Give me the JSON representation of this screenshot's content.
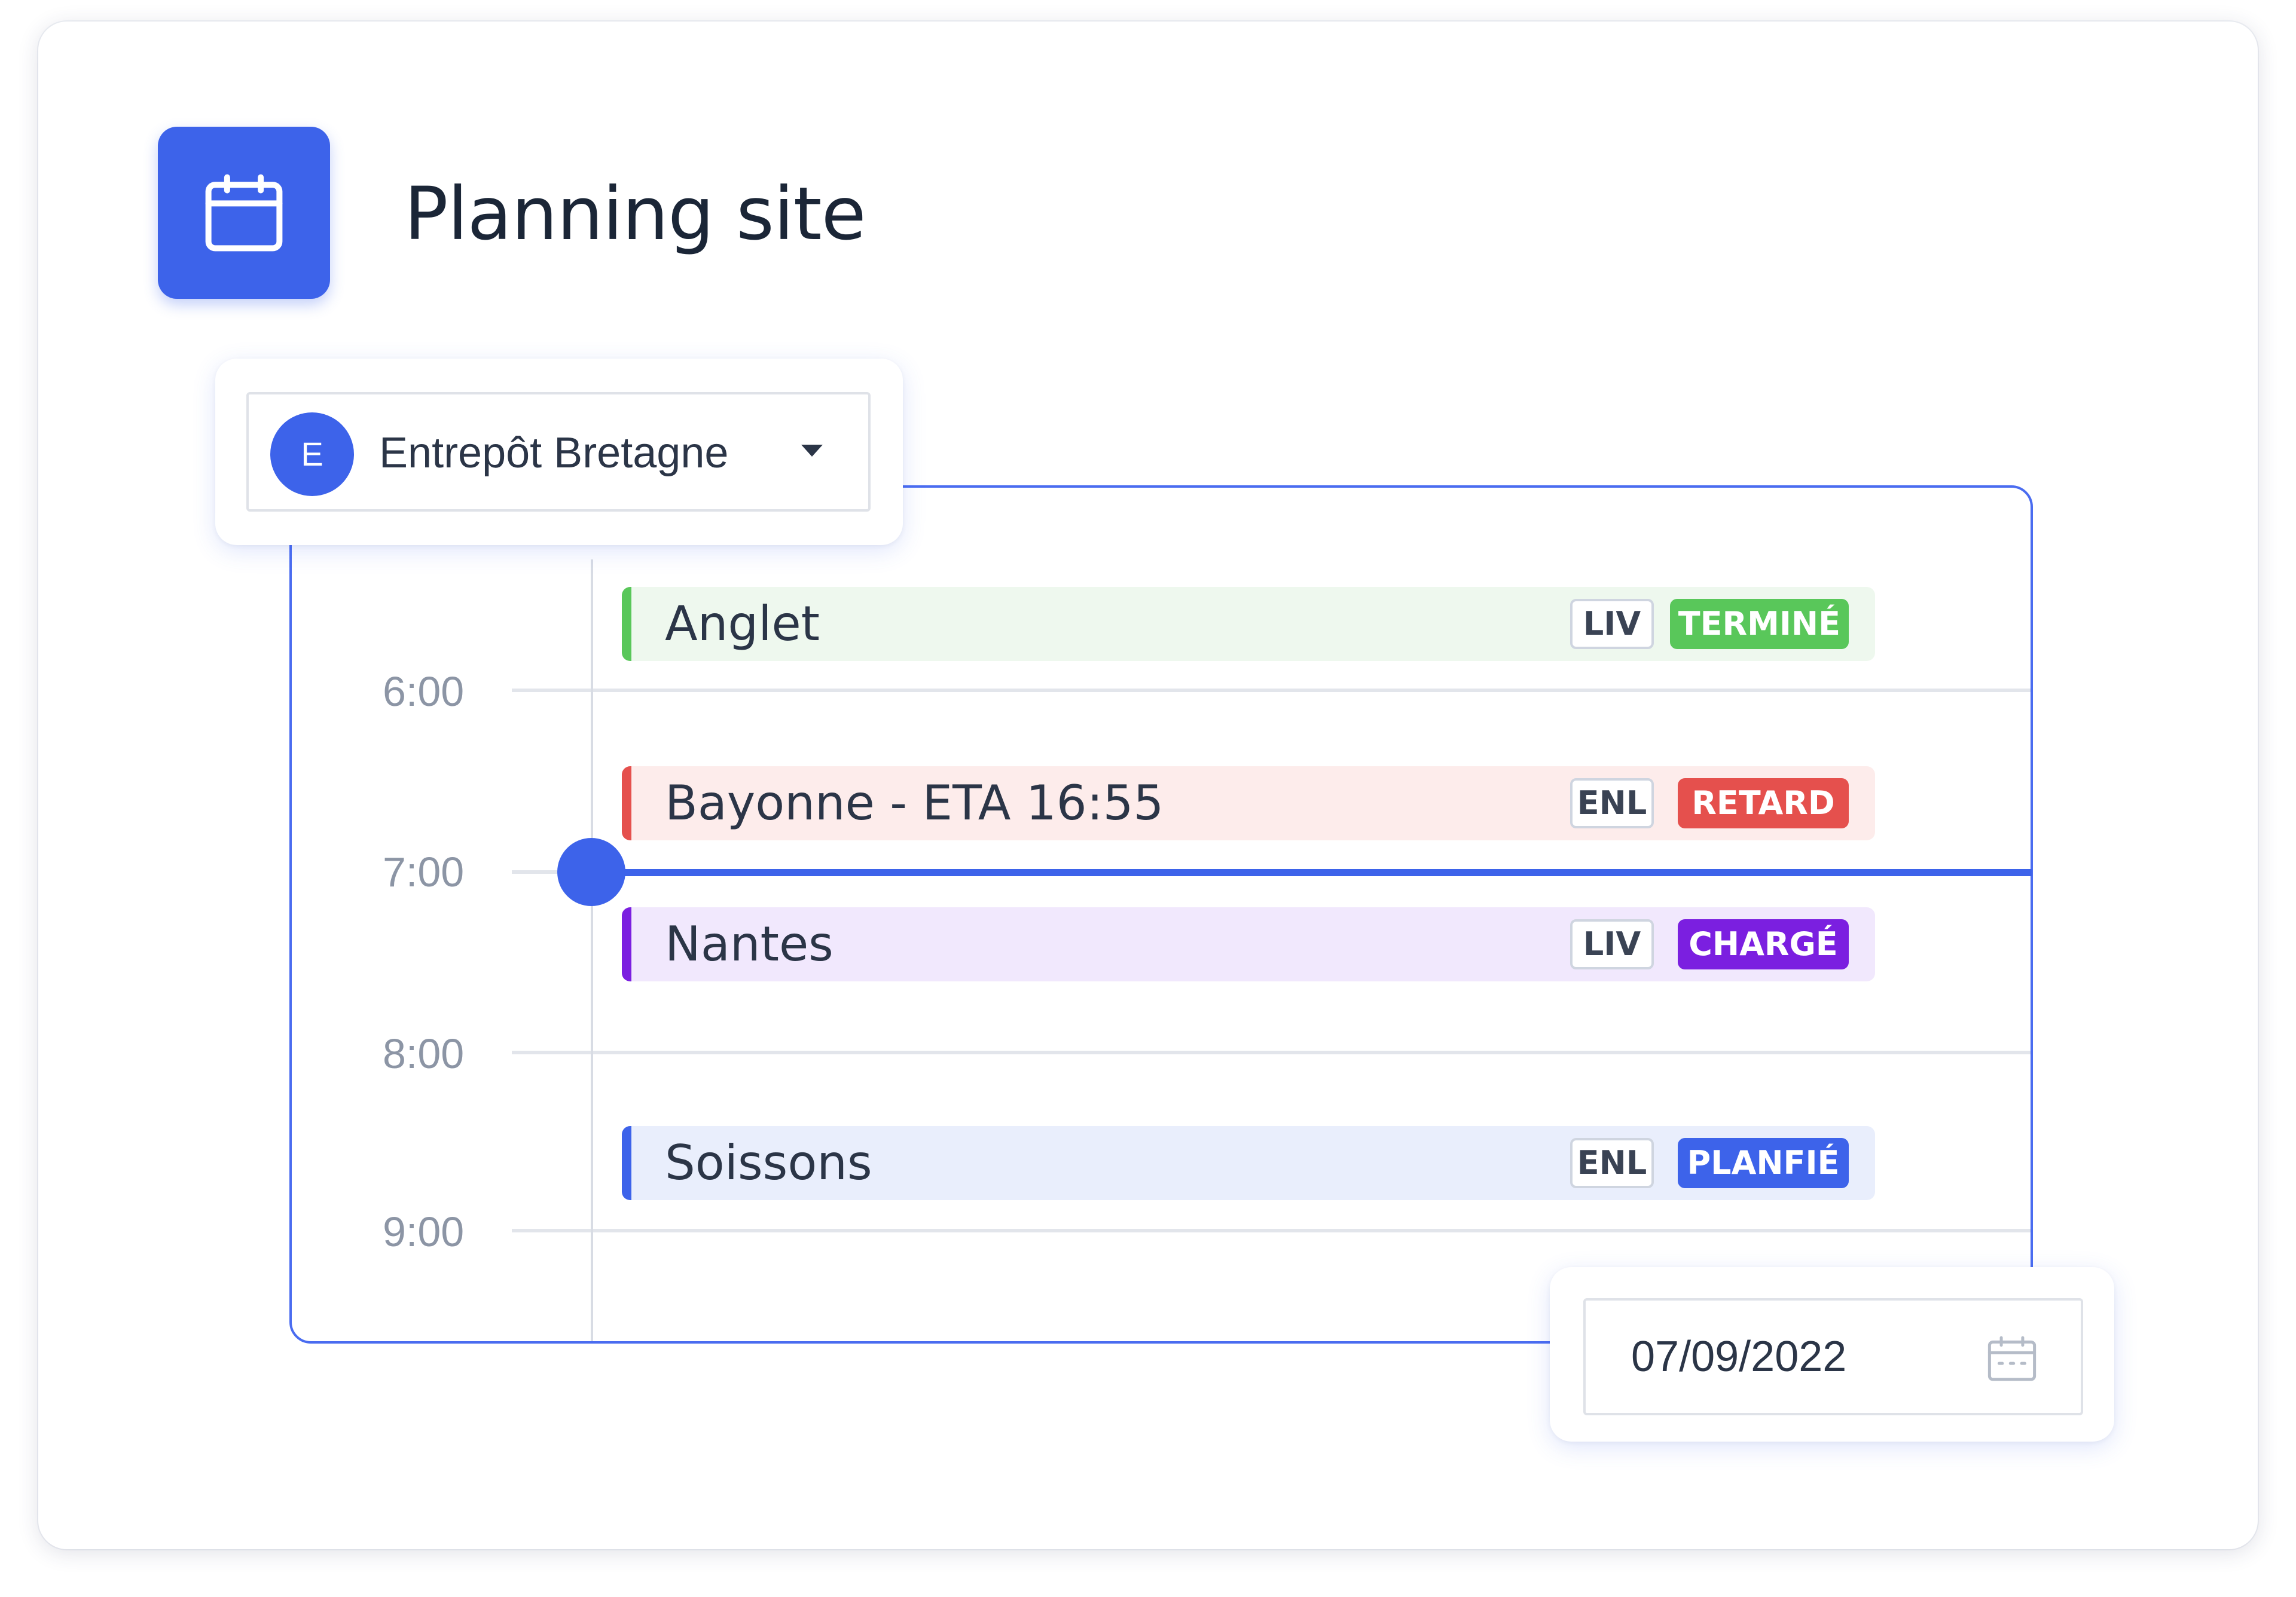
{
  "header": {
    "title": "Planning site",
    "icon": "calendar-icon"
  },
  "site_selector": {
    "avatar_letter": "E",
    "selected": "Entrepôt Bretagne",
    "icon": "chevron-down-icon"
  },
  "timeline": {
    "hours": [
      "6:00",
      "7:00",
      "8:00",
      "9:00"
    ],
    "current_time_indicator": "now-marker"
  },
  "events": [
    {
      "name": "Anglet",
      "type": "LIV",
      "status": "TERMINÉ",
      "accent": "#59c75a",
      "bg": "#eef8ee",
      "status_color": "#59c75a"
    },
    {
      "name": "Bayonne - ETA 16:55",
      "type": "ENL",
      "status": "RETARD",
      "accent": "#e5504d",
      "bg": "#fdeceb",
      "status_color": "#e5504d"
    },
    {
      "name": "Nantes",
      "type": "LIV",
      "status": "CHARGÉ",
      "accent": "#7b1fe0",
      "bg": "#f1e8fd",
      "status_color": "#7b1fe0"
    },
    {
      "name": "Soissons",
      "type": "ENL",
      "status": "PLANFIÉ",
      "accent": "#3d63ea",
      "bg": "#e9eefc",
      "status_color": "#3d63ea"
    }
  ],
  "date_picker": {
    "value": "07/09/2022",
    "icon": "calendar-icon"
  },
  "colors": {
    "primary": "#3d63ea",
    "text": "#1b2637",
    "muted": "#8c95a5"
  }
}
